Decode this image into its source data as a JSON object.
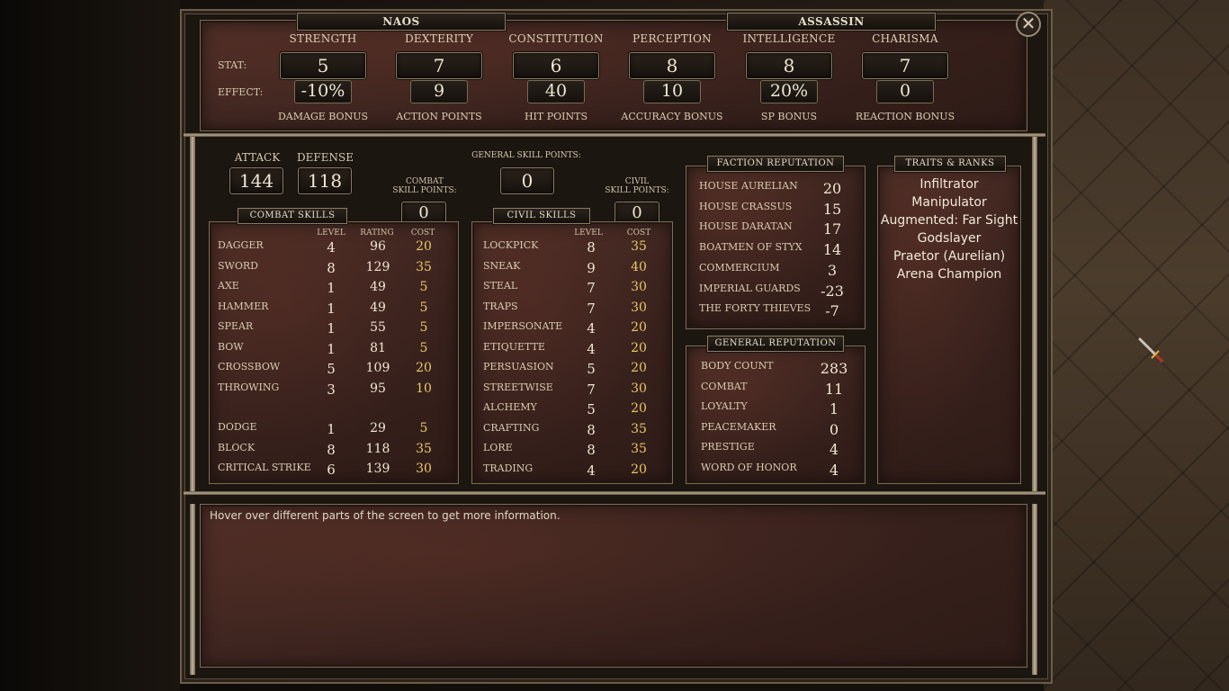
{
  "character": {
    "name": "NAOS",
    "class": "ASSASSIN"
  },
  "close_icon": "close-icon",
  "attributes": [
    {
      "name": "STRENGTH",
      "stat": "5",
      "effect": "-10%",
      "effect_label": "DAMAGE BONUS"
    },
    {
      "name": "DEXTERITY",
      "stat": "7",
      "effect": "9",
      "effect_label": "ACTION POINTS"
    },
    {
      "name": "CONSTITUTION",
      "stat": "6",
      "effect": "40",
      "effect_label": "HIT POINTS"
    },
    {
      "name": "PERCEPTION",
      "stat": "8",
      "effect": "10",
      "effect_label": "ACCURACY BONUS"
    },
    {
      "name": "INTELLIGENCE",
      "stat": "8",
      "effect": "20%",
      "effect_label": "SP BONUS"
    },
    {
      "name": "CHARISMA",
      "stat": "7",
      "effect": "0",
      "effect_label": "REACTION BONUS"
    }
  ],
  "row_labels": {
    "stat": "STAT:",
    "effect": "EFFECT:"
  },
  "attack": {
    "label": "ATTACK",
    "value": "144"
  },
  "defense": {
    "label": "DEFENSE",
    "value": "118"
  },
  "general_skill_points": {
    "label_pre": "GENERAL",
    "label_post": "SKILL POINTS:",
    "value": "0"
  },
  "combat_skill_points": {
    "label_top": "COMBAT",
    "label_bottom": "SKILL POINTS:",
    "value": "0"
  },
  "civil_skill_points": {
    "label_top": "CIVIL",
    "label_bottom": "SKILL POINTS:",
    "value": "0"
  },
  "combat_skills": {
    "title": "COMBAT SKILLS",
    "columns": {
      "level": "LEVEL",
      "rating": "RATING",
      "cost": "COST"
    },
    "rows": [
      {
        "name": "DAGGER",
        "level": "4",
        "rating": "96",
        "cost": "20"
      },
      {
        "name": "SWORD",
        "level": "8",
        "rating": "129",
        "cost": "35"
      },
      {
        "name": "AXE",
        "level": "1",
        "rating": "49",
        "cost": "5"
      },
      {
        "name": "HAMMER",
        "level": "1",
        "rating": "49",
        "cost": "5"
      },
      {
        "name": "SPEAR",
        "level": "1",
        "rating": "55",
        "cost": "5"
      },
      {
        "name": "BOW",
        "level": "1",
        "rating": "81",
        "cost": "5"
      },
      {
        "name": "CROSSBOW",
        "level": "5",
        "rating": "109",
        "cost": "20"
      },
      {
        "name": "THROWING",
        "level": "3",
        "rating": "95",
        "cost": "10"
      },
      {
        "name": "DODGE",
        "level": "1",
        "rating": "29",
        "cost": "5"
      },
      {
        "name": "BLOCK",
        "level": "8",
        "rating": "118",
        "cost": "35"
      },
      {
        "name": "CRITICAL STRIKE",
        "level": "6",
        "rating": "139",
        "cost": "30"
      }
    ]
  },
  "civil_skills": {
    "title": "CIVIL SKILLS",
    "columns": {
      "level": "LEVEL",
      "cost": "COST"
    },
    "rows": [
      {
        "name": "LOCKPICK",
        "level": "8",
        "cost": "35"
      },
      {
        "name": "SNEAK",
        "level": "9",
        "cost": "40"
      },
      {
        "name": "STEAL",
        "level": "7",
        "cost": "30"
      },
      {
        "name": "TRAPS",
        "level": "7",
        "cost": "30"
      },
      {
        "name": "IMPERSONATE",
        "level": "4",
        "cost": "20"
      },
      {
        "name": "ETIQUETTE",
        "level": "4",
        "cost": "20"
      },
      {
        "name": "PERSUASION",
        "level": "5",
        "cost": "20"
      },
      {
        "name": "STREETWISE",
        "level": "7",
        "cost": "30"
      },
      {
        "name": "ALCHEMY",
        "level": "5",
        "cost": "20"
      },
      {
        "name": "CRAFTING",
        "level": "8",
        "cost": "35"
      },
      {
        "name": "LORE",
        "level": "8",
        "cost": "35"
      },
      {
        "name": "TRADING",
        "level": "4",
        "cost": "20"
      }
    ]
  },
  "faction_reputation": {
    "title": "FACTION REPUTATION",
    "rows": [
      {
        "name": "HOUSE AURELIAN",
        "value": "20"
      },
      {
        "name": "HOUSE CRASSUS",
        "value": "15"
      },
      {
        "name": "HOUSE DARATAN",
        "value": "17"
      },
      {
        "name": "BOATMEN OF STYX",
        "value": "14"
      },
      {
        "name": "COMMERCIUM",
        "value": "3"
      },
      {
        "name": "IMPERIAL GUARDS",
        "value": "-23"
      },
      {
        "name": "THE FORTY THIEVES",
        "value": "-7"
      }
    ]
  },
  "general_reputation": {
    "title": "GENERAL REPUTATION",
    "rows": [
      {
        "name": "BODY COUNT",
        "value": "283"
      },
      {
        "name": "COMBAT",
        "value": "11"
      },
      {
        "name": "LOYALTY",
        "value": "1"
      },
      {
        "name": "PEACEMAKER",
        "value": "0"
      },
      {
        "name": "PRESTIGE",
        "value": "4"
      },
      {
        "name": "WORD OF HONOR",
        "value": "4"
      }
    ]
  },
  "traits": {
    "title": "TRAITS & RANKS",
    "items": [
      "Infiltrator",
      "Manipulator",
      "Augmented: Far Sight",
      "Godslayer",
      "Praetor (Aurelian)",
      "Arena Champion"
    ]
  },
  "info_text": "Hover over different parts of the screen to get more information."
}
